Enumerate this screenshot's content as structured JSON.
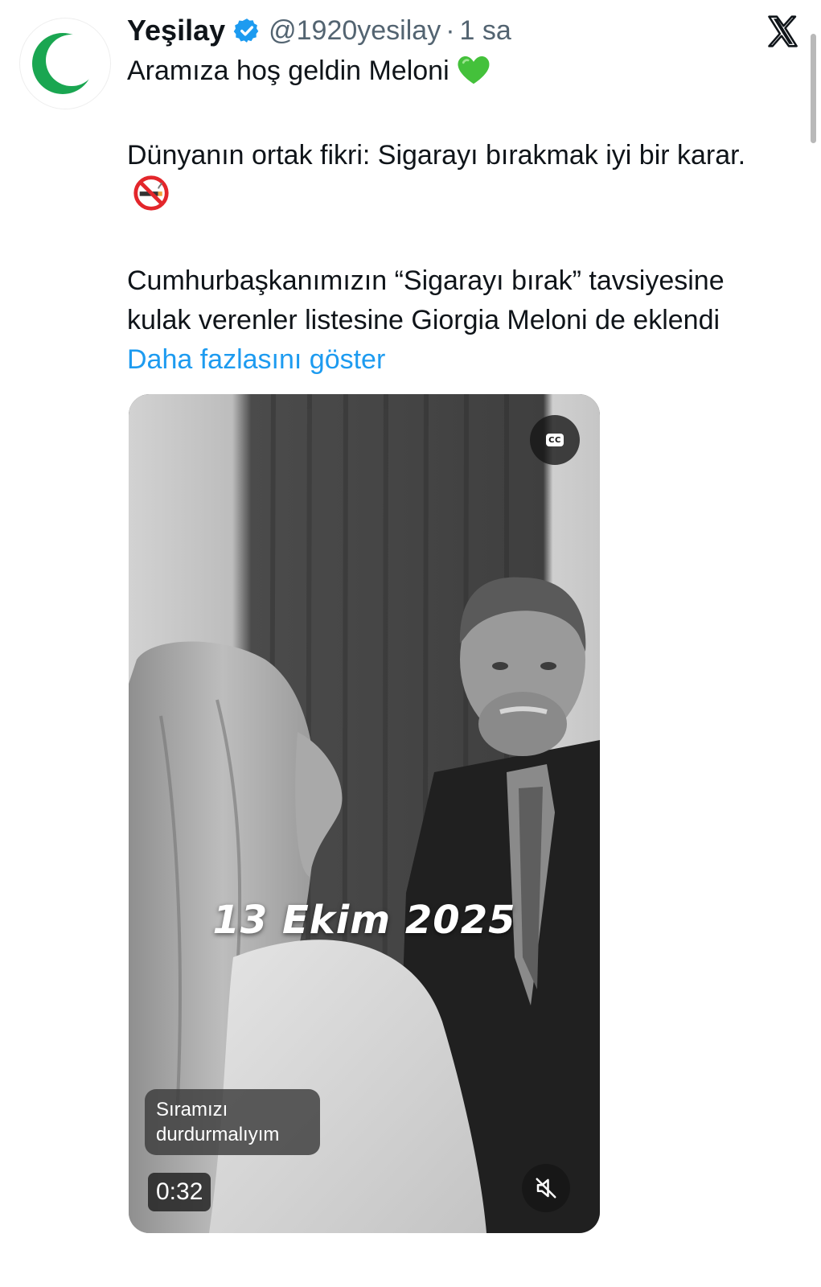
{
  "account": {
    "display_name": "Yeşilay",
    "handle": "@1920yesilay",
    "separator": "·",
    "time": "1 sa",
    "avatar_icon": "green-crescent-icon",
    "verified_icon": "verified-badge-icon",
    "verified_color": "#1d9bf0",
    "logo_color": "#1aa651"
  },
  "app": {
    "brand_icon": "x-logo-icon"
  },
  "tweet": {
    "line1": "Aramıza hoş geldin Meloni",
    "emoji1": "green-heart-icon",
    "paragraph2": "Dünyanın ortak fikri: Sigarayı bırakmak iyi bir karar.",
    "emoji2": "no-smoking-icon",
    "paragraph3": "Cumhurbaşkanımızın “Sigarayı bırak” tavsiyesine kulak verenler listesine Giorgia Meloni de eklendi",
    "show_more": "Daha fazlasını göster",
    "link_color": "#1d9bf0"
  },
  "video": {
    "cc_label": "CC",
    "date_overlay": "13 Ekim 2025",
    "caption": "Sıramızı durdurmalıyım",
    "duration": "0:32",
    "mute_icon": "muted-speaker-icon",
    "cc_icon": "closed-captions-icon"
  }
}
